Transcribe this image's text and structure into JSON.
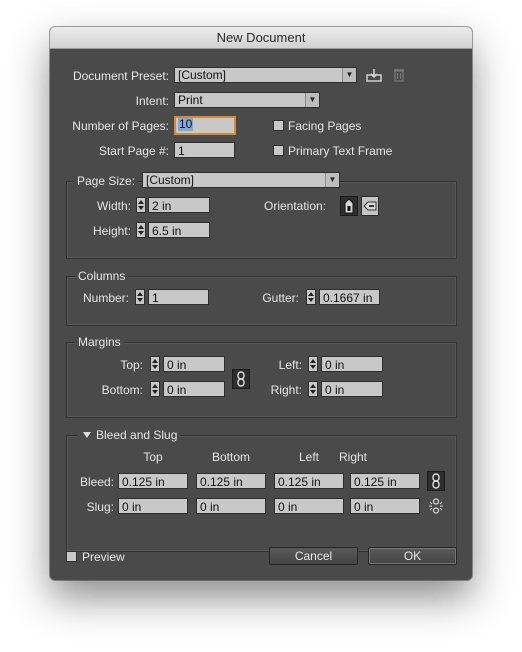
{
  "window": {
    "title": "New Document"
  },
  "preset": {
    "label": "Document Preset:",
    "value": "[Custom]"
  },
  "intent": {
    "label": "Intent:",
    "value": "Print"
  },
  "pages": {
    "num_label": "Number of Pages:",
    "num_value": "10",
    "start_label": "Start Page #:",
    "start_value": "1"
  },
  "options": {
    "facing_pages": {
      "label": "Facing Pages",
      "checked": false
    },
    "primary_text_frame": {
      "label": "Primary Text Frame",
      "checked": false
    }
  },
  "page_size": {
    "label": "Page Size:",
    "value": "[Custom]",
    "width_label": "Width:",
    "width_value": "2 in",
    "height_label": "Height:",
    "height_value": "6.5 in",
    "orientation_label": "Orientation:"
  },
  "columns": {
    "title": "Columns",
    "number_label": "Number:",
    "number_value": "1",
    "gutter_label": "Gutter:",
    "gutter_value": "0.1667 in"
  },
  "margins": {
    "title": "Margins",
    "top_label": "Top:",
    "top_value": "0 in",
    "bottom_label": "Bottom:",
    "bottom_value": "0 in",
    "left_label": "Left:",
    "left_value": "0 in",
    "right_label": "Right:",
    "right_value": "0 in"
  },
  "bleed_slug": {
    "title": "Bleed and Slug",
    "columns": [
      "Top",
      "Bottom",
      "Left",
      "Right"
    ],
    "bleed_label": "Bleed:",
    "bleed_values": [
      "0.125 in",
      "0.125 in",
      "0.125 in",
      "0.125 in"
    ],
    "slug_label": "Slug:",
    "slug_values": [
      "0 in",
      "0 in",
      "0 in",
      "0 in"
    ]
  },
  "footer": {
    "preview_label": "Preview",
    "cancel_label": "Cancel",
    "ok_label": "OK"
  },
  "colors": {
    "window_bg": "#4a4a4a",
    "field_bg": "#c8c8c8",
    "focus": "#d9892e",
    "selection": "#7fa9d9"
  }
}
